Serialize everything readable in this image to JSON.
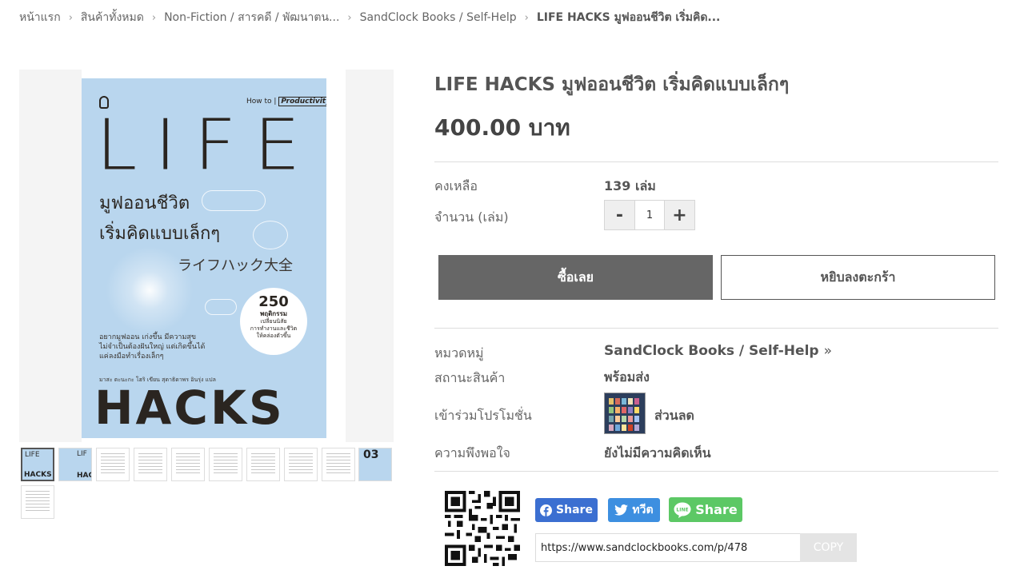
{
  "breadcrumb": {
    "items": [
      "หน้าแรก",
      "สินค้าทั้งหมด",
      "Non-Fiction / สารคดี / พัฒนาตน...",
      "SandClock Books / Self-Help",
      "LIFE HACKS มูฟออนชีวิต เริ่มคิด..."
    ]
  },
  "cover": {
    "howto_prefix": "How to |",
    "howto_tag": "Productivity!",
    "title_en": "LIFE",
    "title_th_line1": "มูฟออนชีวิต",
    "title_th_line2": "เริ่มคิดแบบเล็กๆ",
    "title_jp": "ライフハック大全",
    "badge_number": "250",
    "badge_line1": "พฤติกรรม",
    "badge_line2": "เปลี่ยนนิสัย",
    "badge_line3": "การทำงานและชีวิต",
    "badge_line4": "ให้คล่องตัวขึ้น",
    "blurb_line1": "อยากมูฟออน เก่งขึ้น มีความสุข",
    "blurb_line2": "ไม่จำเป็นต้องฝันใหญ่ แต่เกิดขึ้นได้",
    "blurb_line3": "แค่ลงมือทำเรื่องเล็กๆ",
    "author": "มาสะ ตะนะกะ  โฮริ  เขียน   สุดาธิดาพร  อินรุ่ง แปล",
    "title_hacks": "HACKS"
  },
  "thumbnails": {
    "thumb1_top": "LIFE",
    "thumb1_bottom": "HACKS",
    "thumb2_top": "LIF",
    "thumb2_bottom": "HACI",
    "thumb10_label": "03"
  },
  "product": {
    "title": "LIFE HACKS มูฟออนชีวิต เริ่มคิดแบบเล็กๆ",
    "price": "400.00 บาท",
    "stock_label": "คงเหลือ",
    "stock_value": "139 เล่ม",
    "qty_label": "จำนวน (เล่ม)",
    "qty_value": "1",
    "qty_minus": "-",
    "qty_plus": "+",
    "buy_label": "ซื้อเลย",
    "cart_label": "หยิบลงตะกร้า",
    "category_label": "หมวดหมู่",
    "category_value": "SandClock Books / Self-Help",
    "status_label": "สถานะสินค้า",
    "status_value": "พร้อมส่ง",
    "promo_label": "เข้าร่วมโปรโมชั่น",
    "promo_value": "ส่วนลด",
    "rating_label": "ความพึงพอใจ",
    "rating_value": "ยังไม่มีความคิดเห็น"
  },
  "share": {
    "facebook_label": "Share",
    "twitter_label": "ทวีต",
    "line_label": "Share",
    "line_icon_text": "LINE",
    "url": "https://www.sandclockbooks.com/p/478",
    "copy_label": "COPY"
  },
  "colors": {
    "buy_button": "#666666",
    "facebook": "#3b6fd1",
    "twitter": "#3d8fe0",
    "line": "#5cc865",
    "cover_bg": "#b9d6ee"
  }
}
